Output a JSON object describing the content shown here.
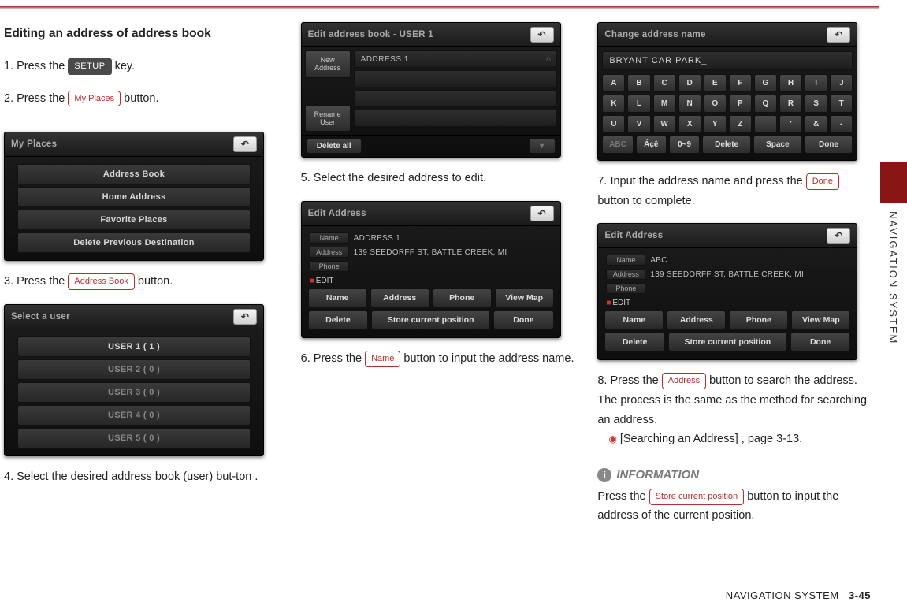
{
  "meta": {
    "side_section": "NAVIGATION SYSTEM",
    "footer_section": "NAVIGATION SYSTEM",
    "page_number": "3-45"
  },
  "col1": {
    "title": "Editing an address of address book",
    "step1_a": "1. Press the ",
    "step1_pill": "SETUP",
    "step1_b": " key.",
    "step2_a": "2. Press the ",
    "step2_pill": "My Places",
    "step2_b": " button.",
    "myplaces": {
      "title": "My Places",
      "items": [
        "Address Book",
        "Home Address",
        "Favorite Places",
        "Delete Previous Destination"
      ]
    },
    "step3_a": "3. Press the ",
    "step3_pill": "Address Book",
    "step3_b": " button.",
    "selectuser": {
      "title": "Select a user",
      "items": [
        "USER 1 ( 1 )",
        "USER 2 ( 0 )",
        "USER 3 ( 0 )",
        "USER 4 ( 0 )",
        "USER 5 ( 0 )"
      ]
    },
    "step4": "4. Select the desired address book (user)  but-ton ."
  },
  "col2": {
    "editbook": {
      "title": "Edit address book - USER 1",
      "side": {
        "new": "New\nAddress",
        "rename": "Rename\nUser"
      },
      "slot1": "ADDRESS 1",
      "delete_all": "Delete all"
    },
    "step5": "5. Select the desired address to edit.",
    "editaddr": {
      "title": "Edit Address",
      "fields": {
        "name_lbl": "Name",
        "name_val": "ADDRESS 1",
        "addr_lbl": "Address",
        "addr_val": "139 SEEDORFF ST, BATTLE CREEK, MI",
        "phone_lbl": "Phone",
        "phone_val": ""
      },
      "edit_lbl": "EDIT",
      "btns": [
        "Name",
        "Address",
        "Phone",
        "View Map",
        "Delete",
        "Store current position",
        "Done"
      ]
    },
    "step6_a": "6. Press the ",
    "step6_pill": "Name",
    "step6_b": " button to input the address name."
  },
  "col3": {
    "kbd": {
      "title": "Change address name",
      "input": "BRYANT CAR PARK_",
      "rows": [
        [
          "A",
          "B",
          "C",
          "D",
          "E",
          "F",
          "G",
          "H",
          "I",
          "J"
        ],
        [
          "K",
          "L",
          "M",
          "N",
          "O",
          "P",
          "Q",
          "R",
          "S",
          "T"
        ],
        [
          "U",
          "V",
          "W",
          "X",
          "Y",
          "Z",
          "",
          "'",
          "&",
          "-"
        ]
      ],
      "bottom": [
        "ABC",
        "Áçê",
        "0~9",
        "Delete",
        "Space",
        "Done"
      ]
    },
    "step7_a": "7. Input the address name and press the ",
    "step7_pill": "Done",
    "step7_b": " button to complete.",
    "editaddr2": {
      "title": "Edit Address",
      "fields": {
        "name_lbl": "Name",
        "name_val": "ABC",
        "addr_lbl": "Address",
        "addr_val": "139 SEEDORFF ST, BATTLE CREEK, MI",
        "phone_lbl": "Phone",
        "phone_val": ""
      },
      "edit_lbl": "EDIT",
      "btns": [
        "Name",
        "Address",
        "Phone",
        "View Map",
        "Delete",
        "Store current position",
        "Done"
      ]
    },
    "step8_a": "8. Press the ",
    "step8_pill": "Address",
    "step8_b": " button to search the address. The process is the same as the method for searching an address.",
    "ref": "[Searching an Address] , page 3-13.",
    "info_head": "INFORMATION",
    "info_a": "Press the ",
    "info_pill": "Store current position",
    "info_b": " button to input the address of the current position."
  }
}
